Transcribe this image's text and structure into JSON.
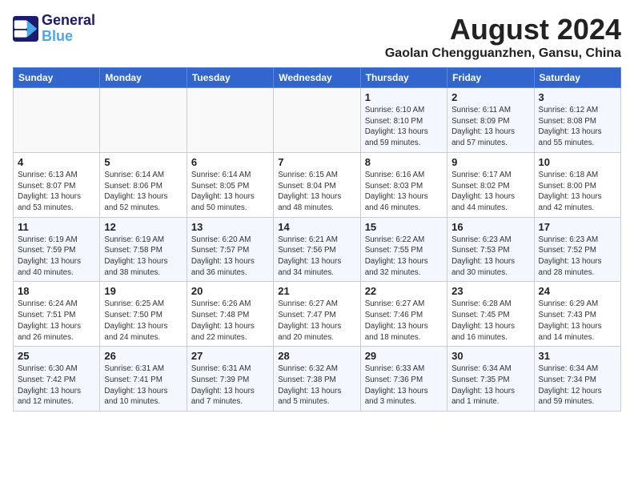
{
  "header": {
    "logo_line1": "General",
    "logo_line2": "Blue",
    "month": "August 2024",
    "location": "Gaolan Chengguanzhen, Gansu, China"
  },
  "days_of_week": [
    "Sunday",
    "Monday",
    "Tuesday",
    "Wednesday",
    "Thursday",
    "Friday",
    "Saturday"
  ],
  "weeks": [
    [
      {
        "day": "",
        "detail": ""
      },
      {
        "day": "",
        "detail": ""
      },
      {
        "day": "",
        "detail": ""
      },
      {
        "day": "",
        "detail": ""
      },
      {
        "day": "1",
        "detail": "Sunrise: 6:10 AM\nSunset: 8:10 PM\nDaylight: 13 hours\nand 59 minutes."
      },
      {
        "day": "2",
        "detail": "Sunrise: 6:11 AM\nSunset: 8:09 PM\nDaylight: 13 hours\nand 57 minutes."
      },
      {
        "day": "3",
        "detail": "Sunrise: 6:12 AM\nSunset: 8:08 PM\nDaylight: 13 hours\nand 55 minutes."
      }
    ],
    [
      {
        "day": "4",
        "detail": "Sunrise: 6:13 AM\nSunset: 8:07 PM\nDaylight: 13 hours\nand 53 minutes."
      },
      {
        "day": "5",
        "detail": "Sunrise: 6:14 AM\nSunset: 8:06 PM\nDaylight: 13 hours\nand 52 minutes."
      },
      {
        "day": "6",
        "detail": "Sunrise: 6:14 AM\nSunset: 8:05 PM\nDaylight: 13 hours\nand 50 minutes."
      },
      {
        "day": "7",
        "detail": "Sunrise: 6:15 AM\nSunset: 8:04 PM\nDaylight: 13 hours\nand 48 minutes."
      },
      {
        "day": "8",
        "detail": "Sunrise: 6:16 AM\nSunset: 8:03 PM\nDaylight: 13 hours\nand 46 minutes."
      },
      {
        "day": "9",
        "detail": "Sunrise: 6:17 AM\nSunset: 8:02 PM\nDaylight: 13 hours\nand 44 minutes."
      },
      {
        "day": "10",
        "detail": "Sunrise: 6:18 AM\nSunset: 8:00 PM\nDaylight: 13 hours\nand 42 minutes."
      }
    ],
    [
      {
        "day": "11",
        "detail": "Sunrise: 6:19 AM\nSunset: 7:59 PM\nDaylight: 13 hours\nand 40 minutes."
      },
      {
        "day": "12",
        "detail": "Sunrise: 6:19 AM\nSunset: 7:58 PM\nDaylight: 13 hours\nand 38 minutes."
      },
      {
        "day": "13",
        "detail": "Sunrise: 6:20 AM\nSunset: 7:57 PM\nDaylight: 13 hours\nand 36 minutes."
      },
      {
        "day": "14",
        "detail": "Sunrise: 6:21 AM\nSunset: 7:56 PM\nDaylight: 13 hours\nand 34 minutes."
      },
      {
        "day": "15",
        "detail": "Sunrise: 6:22 AM\nSunset: 7:55 PM\nDaylight: 13 hours\nand 32 minutes."
      },
      {
        "day": "16",
        "detail": "Sunrise: 6:23 AM\nSunset: 7:53 PM\nDaylight: 13 hours\nand 30 minutes."
      },
      {
        "day": "17",
        "detail": "Sunrise: 6:23 AM\nSunset: 7:52 PM\nDaylight: 13 hours\nand 28 minutes."
      }
    ],
    [
      {
        "day": "18",
        "detail": "Sunrise: 6:24 AM\nSunset: 7:51 PM\nDaylight: 13 hours\nand 26 minutes."
      },
      {
        "day": "19",
        "detail": "Sunrise: 6:25 AM\nSunset: 7:50 PM\nDaylight: 13 hours\nand 24 minutes."
      },
      {
        "day": "20",
        "detail": "Sunrise: 6:26 AM\nSunset: 7:48 PM\nDaylight: 13 hours\nand 22 minutes."
      },
      {
        "day": "21",
        "detail": "Sunrise: 6:27 AM\nSunset: 7:47 PM\nDaylight: 13 hours\nand 20 minutes."
      },
      {
        "day": "22",
        "detail": "Sunrise: 6:27 AM\nSunset: 7:46 PM\nDaylight: 13 hours\nand 18 minutes."
      },
      {
        "day": "23",
        "detail": "Sunrise: 6:28 AM\nSunset: 7:45 PM\nDaylight: 13 hours\nand 16 minutes."
      },
      {
        "day": "24",
        "detail": "Sunrise: 6:29 AM\nSunset: 7:43 PM\nDaylight: 13 hours\nand 14 minutes."
      }
    ],
    [
      {
        "day": "25",
        "detail": "Sunrise: 6:30 AM\nSunset: 7:42 PM\nDaylight: 13 hours\nand 12 minutes."
      },
      {
        "day": "26",
        "detail": "Sunrise: 6:31 AM\nSunset: 7:41 PM\nDaylight: 13 hours\nand 10 minutes."
      },
      {
        "day": "27",
        "detail": "Sunrise: 6:31 AM\nSunset: 7:39 PM\nDaylight: 13 hours\nand 7 minutes."
      },
      {
        "day": "28",
        "detail": "Sunrise: 6:32 AM\nSunset: 7:38 PM\nDaylight: 13 hours\nand 5 minutes."
      },
      {
        "day": "29",
        "detail": "Sunrise: 6:33 AM\nSunset: 7:36 PM\nDaylight: 13 hours\nand 3 minutes."
      },
      {
        "day": "30",
        "detail": "Sunrise: 6:34 AM\nSunset: 7:35 PM\nDaylight: 13 hours\nand 1 minute."
      },
      {
        "day": "31",
        "detail": "Sunrise: 6:34 AM\nSunset: 7:34 PM\nDaylight: 12 hours\nand 59 minutes."
      }
    ]
  ]
}
